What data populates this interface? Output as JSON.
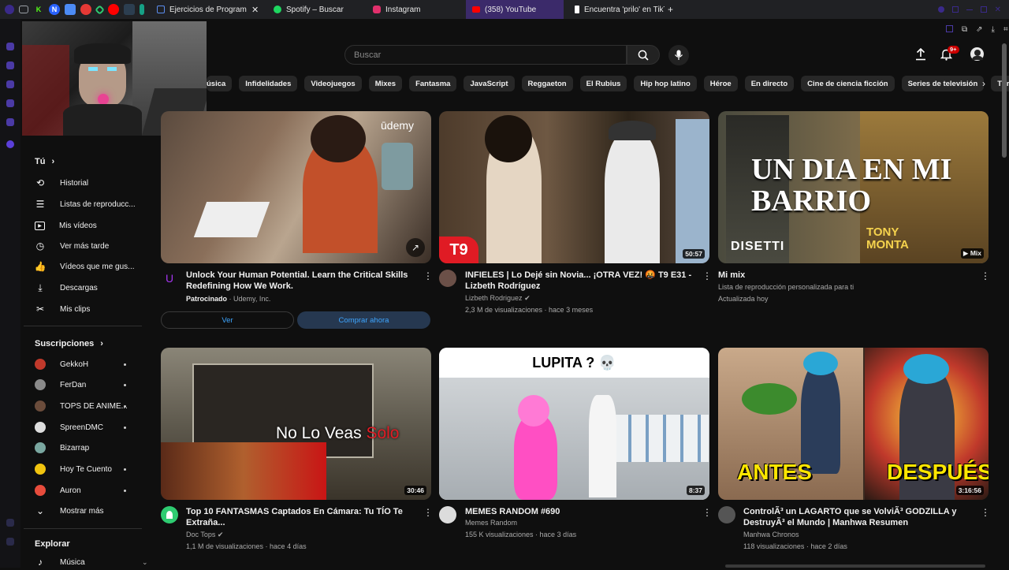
{
  "browser": {
    "tabs": [
      {
        "label": "Ejercicios de Program",
        "color": "#5b8def",
        "active": false
      },
      {
        "label": "Spotify – Buscar",
        "color": "#1ed760",
        "active": false
      },
      {
        "label": "Instagram",
        "color": "#e1306c",
        "active": false
      },
      {
        "label": "(358) YouTube",
        "color": "#ff0000",
        "active": true
      },
      {
        "label": "Encuentra 'prilo' en TikTo",
        "color": "#ffffff",
        "active": false
      }
    ],
    "new_tab": "+",
    "pinned": [
      "K",
      "N"
    ]
  },
  "topbar": {
    "search_placeholder": "Buscar",
    "notif_badge": "9+"
  },
  "chips": [
    "Música",
    "Infidelidades",
    "Videojuegos",
    "Mixes",
    "Fantasma",
    "JavaScript",
    "Reggaeton",
    "El Rubius",
    "Hip hop latino",
    "Héroe",
    "En directo",
    "Cine de ciencia ficción",
    "Series de televisión",
    "Thrillers"
  ],
  "chips_first_visible": "úsica",
  "sidebar": {
    "you_label": "Tú",
    "you_items": [
      {
        "label": "Historial",
        "icon": "history-icon"
      },
      {
        "label": "Listas de reproducc...",
        "icon": "playlists-icon"
      },
      {
        "label": "Mis vídeos",
        "icon": "my-videos-icon"
      },
      {
        "label": "Ver más tarde",
        "icon": "watch-later-icon"
      },
      {
        "label": "Vídeos que me gus...",
        "icon": "liked-icon"
      },
      {
        "label": "Descargas",
        "icon": "download-icon"
      },
      {
        "label": "Mis clips",
        "icon": "clips-icon"
      }
    ],
    "subs_label": "Suscripciones",
    "subs": [
      {
        "label": "GekkoH",
        "color": "#c0392b"
      },
      {
        "label": "FerDan",
        "color": "#8a8a8a"
      },
      {
        "label": "TOPS DE ANIME...",
        "color": "#6b4c3b"
      },
      {
        "label": "SpreenDMC",
        "color": "#dddddd"
      },
      {
        "label": "Bizarrap",
        "color": "#7aa7a0"
      },
      {
        "label": "Hoy Te Cuento",
        "color": "#f1c40f"
      },
      {
        "label": "Auron",
        "color": "#e74c3c"
      }
    ],
    "show_more": "Mostrar más",
    "explore_label": "Explorar",
    "explore_items": [
      {
        "label": "Música",
        "icon": "music-icon"
      }
    ]
  },
  "videos": [
    {
      "title": "Unlock Your Human Potential. Learn the Critical Skills Redefining How We Work.",
      "sponsored": "Patrocinado",
      "channel": "· Udemy, Inc.",
      "overlay": "ūdemy",
      "btn_view": "Ver",
      "btn_buy": "Comprar ahora"
    },
    {
      "title": "INFIELES | Lo Dejé sin Novia... ¡OTRA VEZ! 🤬 T9 E31 - Lizbeth Rodríguez",
      "channel": "Lizbeth Rodriguez",
      "meta": "2,3 M de visualizaciones · hace 3 meses",
      "duration": "50:57",
      "overlay": "T9"
    },
    {
      "title": "Mi mix",
      "channel": "Lista de reproducción personalizada para ti",
      "meta": "Actualizada hoy",
      "duration": "▶ Mix",
      "overlay": "UN DIA EN MI BARRIO",
      "overlay2": "DISETTI",
      "overlay3": "TONY MONTA"
    },
    {
      "title": "Top 10 FANTASMAS Captados En Cámara: Tu TÍO Te Extraña...",
      "channel": "Doc Tops",
      "meta": "1,1 M de visualizaciones · hace 4 días",
      "duration": "30:46",
      "overlay": "No Lo Veas",
      "overlay2": "Solo"
    },
    {
      "title": "MEMES RANDOM #690",
      "channel": "Memes Random",
      "meta": "155 K visualizaciones · hace 3 días",
      "duration": "8:37",
      "overlay": "LUPITA ? 💀"
    },
    {
      "title": "ControlÃ³ un LAGARTO que se VolviÃ³ GODZILLA y DestruyÃ³ el Mundo | Manhwa Resumen",
      "channel": "Manhwa Chronos",
      "meta": "118 visualizaciones · hace 2 días",
      "duration": "3:16:56",
      "overlay": "ANTES",
      "overlay2": "DESPUÉS"
    }
  ]
}
